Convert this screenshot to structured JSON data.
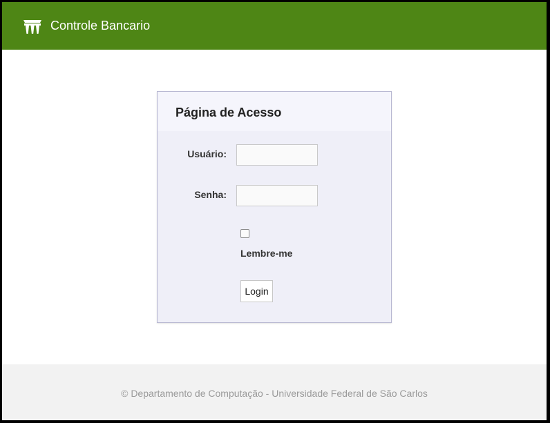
{
  "navbar": {
    "brand_icon": "bank-building-icon",
    "title": "Controle Bancario",
    "color": "#4e8615"
  },
  "login_panel": {
    "title": "Página de Acesso",
    "username_label": "Usuário:",
    "username_value": "",
    "password_label": "Senha:",
    "password_value": "",
    "remember_checked": false,
    "remember_label": "Lembre-me",
    "login_button": "Login"
  },
  "footer": {
    "text": "© Departamento de Computação - Universidade Federal de São Carlos"
  }
}
